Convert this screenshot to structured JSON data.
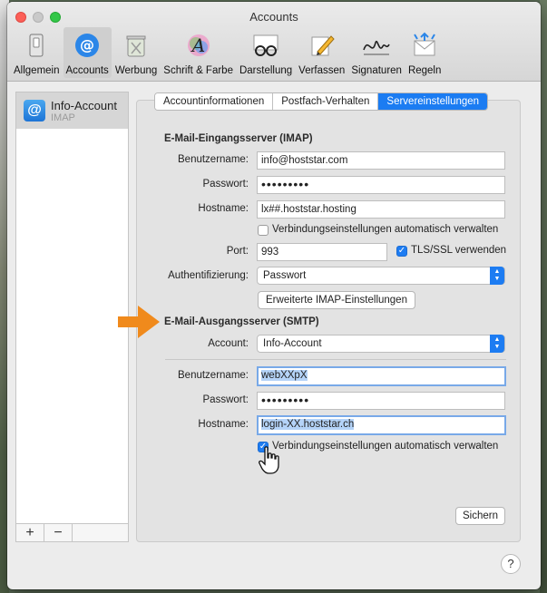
{
  "window": {
    "title": "Accounts"
  },
  "toolbar": [
    {
      "label": "Allgemein",
      "icon": "switch-icon"
    },
    {
      "label": "Accounts",
      "icon": "at-icon"
    },
    {
      "label": "Werbung",
      "icon": "trash-icon"
    },
    {
      "label": "Schrift & Farbe",
      "icon": "font-color-icon"
    },
    {
      "label": "Darstellung",
      "icon": "glasses-icon"
    },
    {
      "label": "Verfassen",
      "icon": "pencil-icon"
    },
    {
      "label": "Signaturen",
      "icon": "signature-icon"
    },
    {
      "label": "Regeln",
      "icon": "rules-icon"
    }
  ],
  "sidebar": {
    "account": {
      "name": "Info-Account",
      "type": "IMAP"
    },
    "add_label": "+",
    "remove_label": "−"
  },
  "tabs": [
    "Accountinformationen",
    "Postfach-Verhalten",
    "Servereinstellungen"
  ],
  "imap": {
    "heading": "E-Mail-Eingangsserver (IMAP)",
    "username_label": "Benutzername:",
    "username": "info@hoststar.com",
    "password_label": "Passwort:",
    "password": "•••••••••",
    "hostname_label": "Hostname:",
    "hostname": "lx##.hoststar.hosting",
    "auto_connect_label": "Verbindungseinstellungen automatisch verwalten",
    "port_label": "Port:",
    "port": "993",
    "tls_label": "TLS/SSL verwenden",
    "auth_label": "Authentifizierung:",
    "auth": "Passwort",
    "advanced_button": "Erweiterte IMAP-Einstellungen"
  },
  "smtp": {
    "heading": "E-Mail-Ausgangsserver (SMTP)",
    "account_label": "Account:",
    "account": "Info-Account",
    "username_label": "Benutzername:",
    "username": "webXXpX",
    "password_label": "Passwort:",
    "password": "•••••••••",
    "hostname_label": "Hostname:",
    "hostname": "login-XX.hoststar.ch",
    "auto_connect_label": "Verbindungseinstellungen automatisch verwalten"
  },
  "save_button": "Sichern",
  "help_label": "?",
  "colors": {
    "accent": "#1b7cf2",
    "arrow": "#f08a1c"
  }
}
